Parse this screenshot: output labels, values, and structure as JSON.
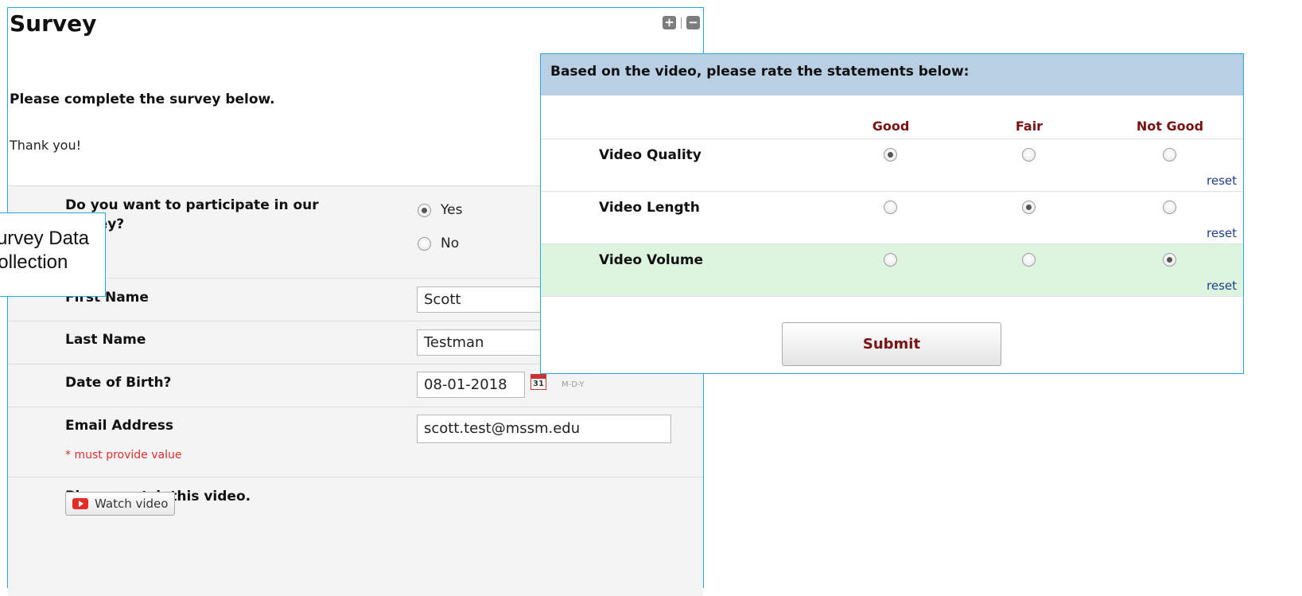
{
  "survey": {
    "title": "Survey",
    "expand_icon": "+",
    "collapse_icon": "−",
    "instructions": "Please complete the survey below.",
    "thanks": "Thank you!",
    "participate": {
      "question": "Do you want to participate in our survey?",
      "options": [
        {
          "label": "Yes",
          "selected": true
        },
        {
          "label": "No",
          "selected": false
        }
      ]
    },
    "first_name": {
      "label": "First Name",
      "value": "Scott"
    },
    "last_name": {
      "label": "Last Name",
      "value": "Testman"
    },
    "dob": {
      "label": "Date of Birth?",
      "value": "08-01-2018",
      "format": "M-D-Y",
      "calendar_day": "31"
    },
    "email": {
      "label": "Email Address",
      "value": "scott.test@mssm.edu",
      "required_note": "* must provide value"
    },
    "video": {
      "label": "Please watch this video.",
      "button_label": "Watch video"
    }
  },
  "callout": {
    "text": "Survey Data\nCollection"
  },
  "matrix": {
    "header": "Based on the video, please rate the statements below:",
    "columns": [
      "Good",
      "Fair",
      "Not Good"
    ],
    "rows": [
      {
        "label": "Video Quality",
        "selected": 0,
        "reset": "reset"
      },
      {
        "label": "Video Length",
        "selected": 1,
        "reset": "reset"
      },
      {
        "label": "Video Volume",
        "selected": 2,
        "reset": "reset"
      }
    ],
    "submit_label": "Submit"
  },
  "colors": {
    "border_accent": "#2aa8d8",
    "matrix_header_bg": "#b8cfe4",
    "highlight_row_bg": "#ddf5de",
    "column_header_text": "#7a1212",
    "required_text": "#e03030",
    "link_text": "#1d3f8a"
  }
}
